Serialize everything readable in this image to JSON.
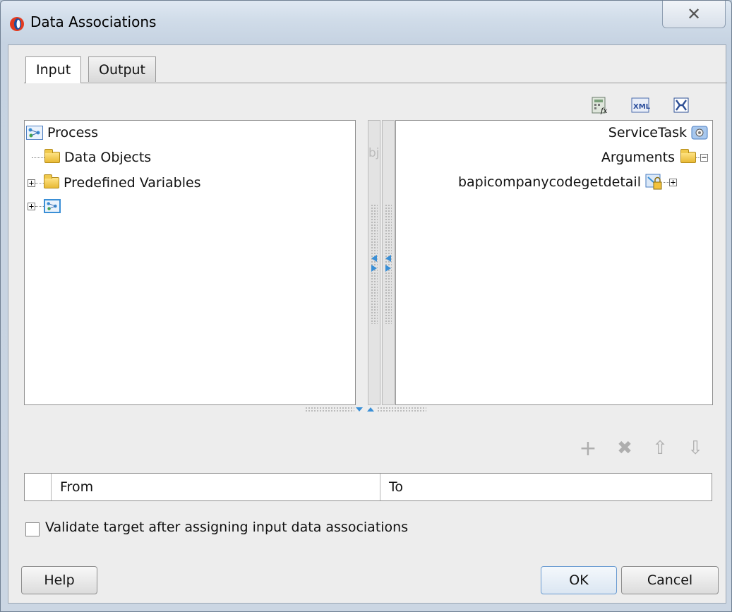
{
  "window": {
    "title": "Data Associations",
    "close_glyph": "✕"
  },
  "tabs": [
    {
      "label": "Input"
    },
    {
      "label": "Output"
    }
  ],
  "toolbar": {
    "icons": [
      "expression-builder-icon",
      "xml-literal-icon",
      "split-icon"
    ]
  },
  "source_tree": {
    "root": "Process",
    "items": [
      {
        "label": "Data Objects"
      },
      {
        "label": "Predefined Variables"
      }
    ],
    "truncated_overlap_text": "bje"
  },
  "target_tree": {
    "root": "ServiceTask",
    "arguments": "Arguments",
    "item": "bapicompanycodegetdetail"
  },
  "actions": {
    "add": "+",
    "delete": "✖",
    "up": "⇧",
    "down": "⇩"
  },
  "table": {
    "columns": [
      "From",
      "To"
    ]
  },
  "validate": {
    "label": "Validate target after assigning input data associations",
    "checked": false
  },
  "buttons": {
    "help": "Help",
    "ok": "OK",
    "cancel": "Cancel"
  },
  "colors": {
    "accent": "#3a8fd6",
    "window_frame": "#cfdbe8"
  }
}
